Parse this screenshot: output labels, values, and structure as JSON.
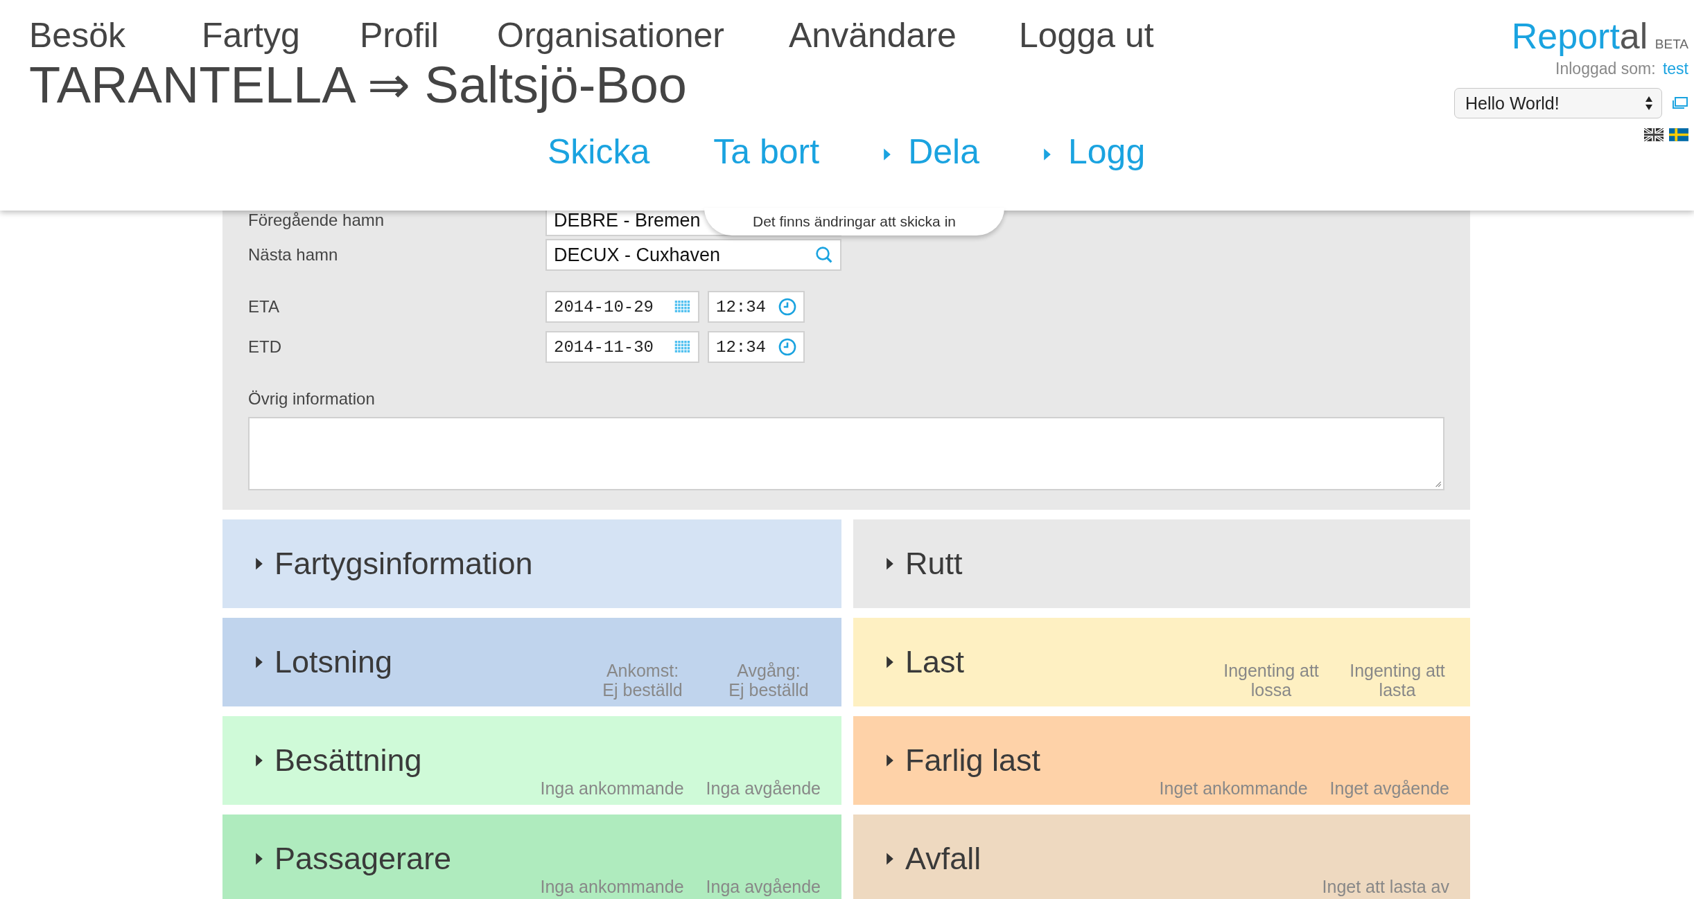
{
  "nav": [
    "Besök",
    "Fartyg",
    "Profil",
    "Organisationer",
    "Användare",
    "Logga ut"
  ],
  "title": "TARANTELLA ⇒ Saltsjö-Boo",
  "brand": {
    "name_accent": "Report",
    "name_rest": "al",
    "badge": "BETA"
  },
  "user": {
    "label": "Inloggad som:",
    "name": "test"
  },
  "organization_select": {
    "value": "Hello World!"
  },
  "languages": [
    {
      "kind": "en",
      "selected": false
    },
    {
      "kind": "sv",
      "selected": true
    }
  ],
  "actions": [
    {
      "label": "Skicka",
      "expandable": false
    },
    {
      "label": "Ta bort",
      "expandable": false
    },
    {
      "label": "Dela",
      "expandable": true
    },
    {
      "label": "Logg",
      "expandable": true
    }
  ],
  "notice": "Det finns ändringar att skicka in",
  "fields": [
    {
      "label": "Föregående hamn",
      "kind": "port",
      "value": "DEBRE - Bremen"
    },
    {
      "label": "Nästa hamn",
      "kind": "port",
      "value": "DECUX - Cuxhaven"
    },
    {
      "label": "ETA",
      "kind": "datetime",
      "date": "2014-10-29",
      "time": "12:34"
    },
    {
      "label": "ETD",
      "kind": "datetime",
      "date": "2014-11-30",
      "time": "12:34"
    },
    {
      "label": "Övrig information",
      "kind": "textarea"
    }
  ],
  "sections": [
    {
      "title": "Fartygsinformation",
      "color": "#d5e3f4"
    },
    {
      "title": "Rutt",
      "color": "#e8e8e8"
    },
    {
      "title": "Lotsning",
      "color": "#c0d4ed",
      "details": [
        "Ankomst:\nEj beställd",
        "Avgång:\nEj beställd"
      ]
    },
    {
      "title": "Last",
      "color": "#fef0c2",
      "details": [
        "Ingenting att\nlossa",
        "Ingenting att\nlasta"
      ]
    },
    {
      "title": "Besättning",
      "color": "#cffad8",
      "details": [
        "Inga ankommande",
        "Inga avgående"
      ]
    },
    {
      "title": "Farlig last",
      "color": "#fed2a8",
      "details": [
        "Inget ankommande",
        "Inget avgående"
      ]
    },
    {
      "title": "Passagerare",
      "color": "#afebbe",
      "details": [
        "Inga ankommande",
        "Inga avgående"
      ]
    },
    {
      "title": "Avfall",
      "color": "#eed9c0",
      "details": [
        "Inget att lasta av"
      ]
    }
  ]
}
